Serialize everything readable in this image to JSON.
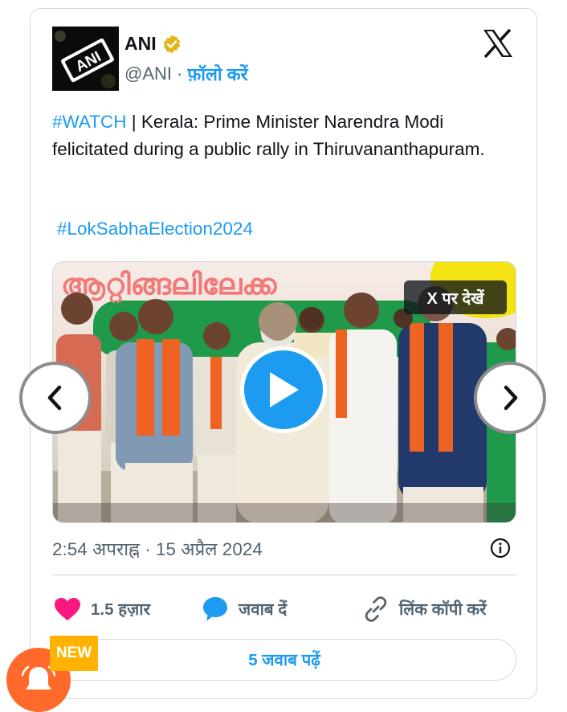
{
  "tweet": {
    "author_name": "ANI",
    "handle": "@ANI",
    "separator": "·",
    "follow_label": "फ़ॉलो करें",
    "hashtag_watch": "#WATCH",
    "text_body": " | Kerala: Prime Minister Narendra Modi felicitated during a public rally in Thiruvananthapuram.",
    "hashtag_election": "#LokSabhaElection2024",
    "avatar_text": "ANI",
    "media": {
      "view_on_x_label": "X पर देखें",
      "banner_text": "ആറ്റിങ്ങലിലേക്ക"
    },
    "timestamp": "2:54 अपराह्न · 15 अप्रैल 2024",
    "actions": {
      "likes": "1.5 हज़ार",
      "reply_label": "जवाब दें",
      "copy_link_label": "लिंक कॉपी करें"
    },
    "read_replies_label": "5 जवाब पढ़ें"
  },
  "overlay": {
    "new_badge": "NEW"
  },
  "icons": {
    "verified": "verified-badge-icon",
    "x_logo": "x-logo-icon",
    "play": "play-icon",
    "info": "info-icon",
    "heart": "heart-icon",
    "reply": "reply-bubble-icon",
    "link": "link-icon",
    "prev": "chevron-left-icon",
    "next": "chevron-right-icon",
    "bell": "bell-icon"
  },
  "colors": {
    "accent": "#1d9bf0",
    "like": "#f91880",
    "verified": "#e2b719",
    "new_badge": "#ffb300",
    "bell_bg": "#ff6a2b"
  }
}
